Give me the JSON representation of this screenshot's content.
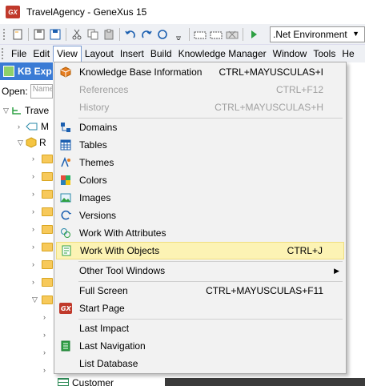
{
  "window": {
    "title": "TravelAgency - GeneXus 15",
    "logo_text": "GX"
  },
  "toolbar": {
    "environment": ".Net Environment"
  },
  "menubar": {
    "items": [
      "File",
      "Edit",
      "View",
      "Layout",
      "Insert",
      "Build",
      "Knowledge Manager",
      "Window",
      "Tools",
      "He"
    ]
  },
  "kb_explorer": {
    "title": "KB Exp",
    "open_label": "Open:",
    "open_placeholder": "Name",
    "tree": [
      "Trave",
      "M",
      "R",
      "Customer"
    ]
  },
  "view_menu": {
    "items": [
      {
        "label": "Knowledge Base Information",
        "shortcut": "CTRL+MAYUSCULAS+I"
      },
      {
        "label": "References",
        "shortcut": "CTRL+F12"
      },
      {
        "label": "History",
        "shortcut": "CTRL+MAYUSCULAS+H"
      },
      {
        "label": "Domains",
        "shortcut": ""
      },
      {
        "label": "Tables",
        "shortcut": ""
      },
      {
        "label": "Themes",
        "shortcut": ""
      },
      {
        "label": "Colors",
        "shortcut": ""
      },
      {
        "label": "Images",
        "shortcut": ""
      },
      {
        "label": "Versions",
        "shortcut": ""
      },
      {
        "label": "Work With Attributes",
        "shortcut": ""
      },
      {
        "label": "Work With Objects",
        "shortcut": "CTRL+J"
      },
      {
        "label": "Other Tool Windows",
        "shortcut": ""
      },
      {
        "label": "Full Screen",
        "shortcut": "CTRL+MAYUSCULAS+F11"
      },
      {
        "label": "Start Page",
        "shortcut": ""
      },
      {
        "label": "Last Impact",
        "shortcut": ""
      },
      {
        "label": "Last Navigation",
        "shortcut": ""
      },
      {
        "label": "List Database",
        "shortcut": ""
      }
    ]
  }
}
